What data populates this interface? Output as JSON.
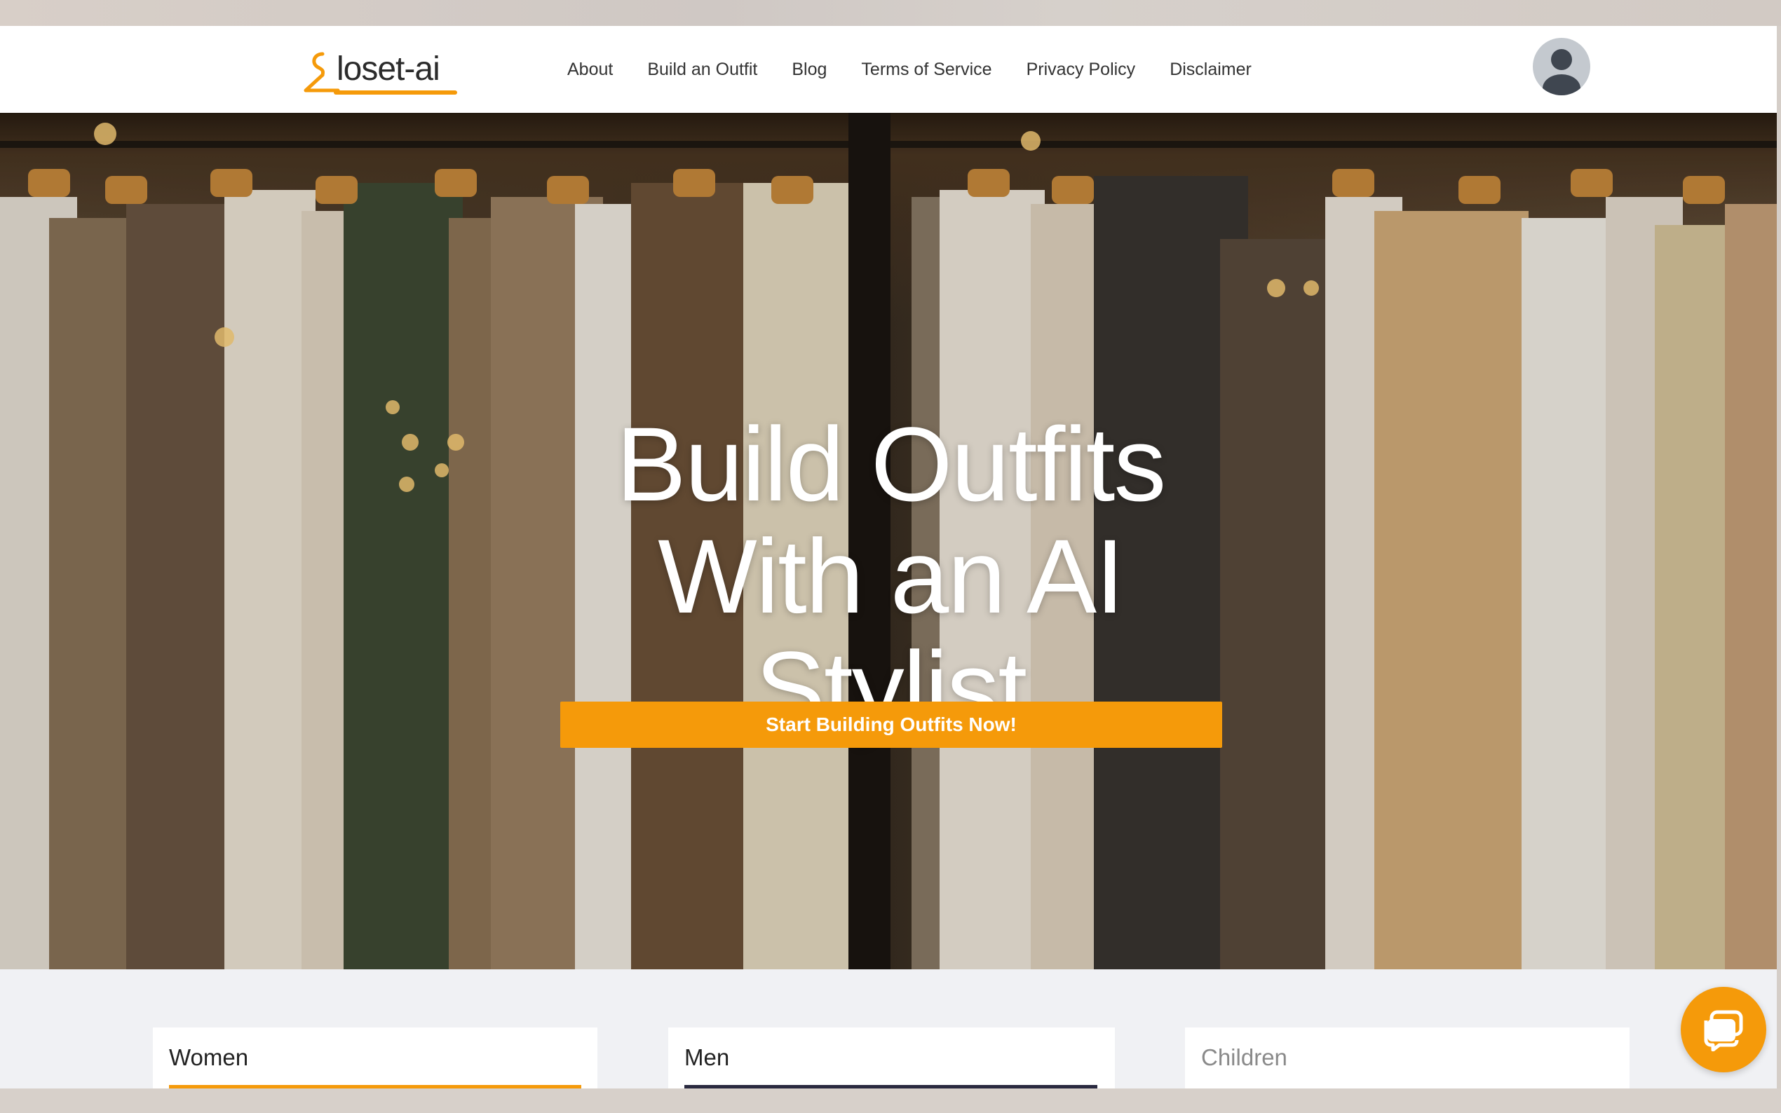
{
  "brand": {
    "logo_text": "loset-ai",
    "accent_color": "#f59a0a"
  },
  "nav": {
    "links": [
      {
        "label": "About"
      },
      {
        "label": "Build an Outfit"
      },
      {
        "label": "Blog"
      },
      {
        "label": "Terms of Service"
      },
      {
        "label": "Privacy Policy"
      },
      {
        "label": "Disclaimer"
      }
    ],
    "avatar_icon": "user-avatar-icon"
  },
  "hero": {
    "title_line1": "Build Outfits",
    "title_line2": "With an AI",
    "title_line3": "Stylist",
    "cta_label": "Start Building Outfits Now!"
  },
  "categories": [
    {
      "label": "Women",
      "bar_color": "#f59a0a"
    },
    {
      "label": "Men",
      "bar_color": "#2a2a40"
    },
    {
      "label": "Children",
      "bar_color": ""
    }
  ],
  "chat": {
    "icon": "chat-bubble-icon"
  }
}
